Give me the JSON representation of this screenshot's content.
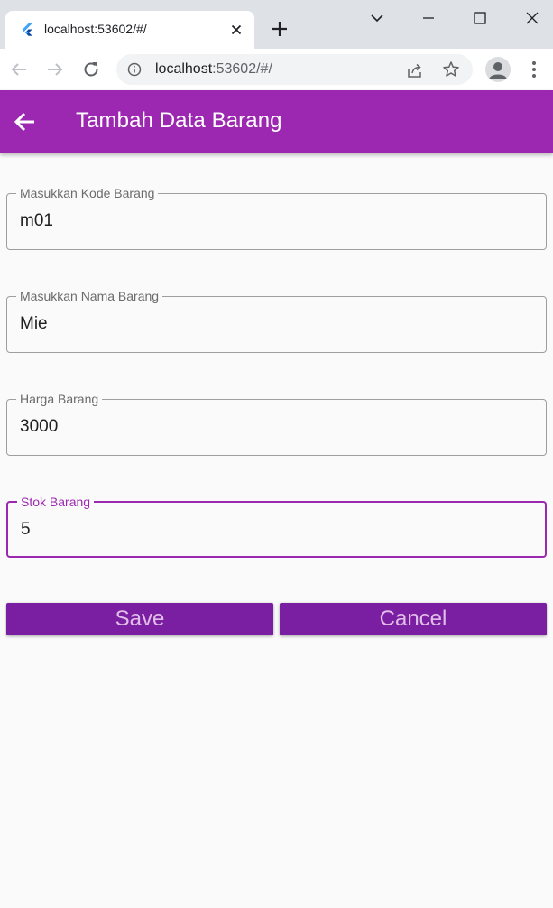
{
  "browser": {
    "tab_title": "localhost:53602/#/",
    "url_host": "localhost",
    "url_path": ":53602/#/"
  },
  "appbar": {
    "title": "Tambah Data Barang",
    "color": "#9c27b0"
  },
  "form": {
    "fields": [
      {
        "label": "Masukkan Kode Barang",
        "value": "m01",
        "focused": false
      },
      {
        "label": "Masukkan Nama Barang",
        "value": "Mie",
        "focused": false
      },
      {
        "label": "Harga Barang",
        "value": "3000",
        "focused": false
      },
      {
        "label": "Stok Barang",
        "value": "5",
        "focused": true
      }
    ]
  },
  "buttons": {
    "save_label": "Save",
    "cancel_label": "Cancel",
    "color": "#7b1fa2"
  }
}
